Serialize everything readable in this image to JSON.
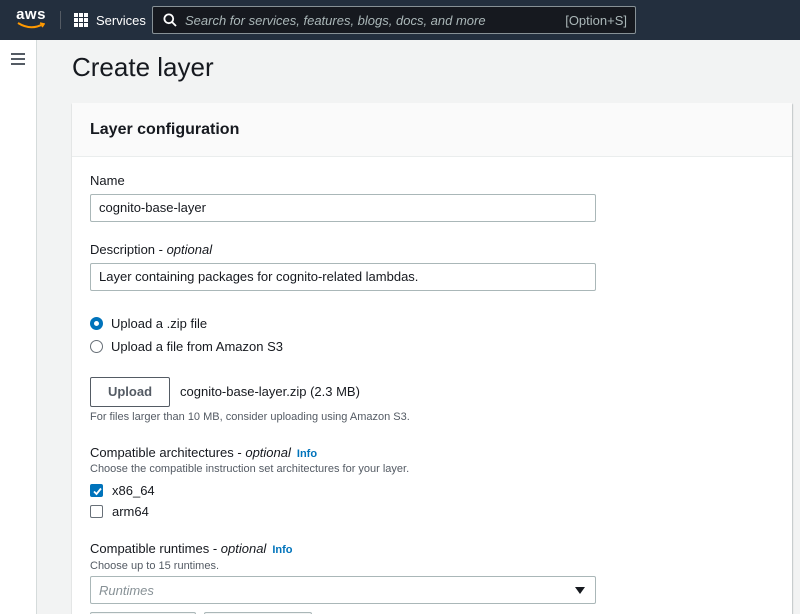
{
  "nav": {
    "logo_text": "aws",
    "services_label": "Services",
    "search_placeholder": "Search for services, features, blogs, docs, and more",
    "search_shortcut": "[Option+S]"
  },
  "page": {
    "title": "Create layer"
  },
  "panel": {
    "title": "Layer configuration",
    "name_label": "Name",
    "name_value": "cognito-base-layer",
    "description_label": "Description - ",
    "description_optional": "optional",
    "description_value": "Layer containing packages for cognito-related lambdas.",
    "upload_options": [
      {
        "label": "Upload a .zip file",
        "selected": true
      },
      {
        "label": "Upload a file from Amazon S3",
        "selected": false
      }
    ],
    "upload_button": "Upload",
    "file_name": "cognito-base-layer.zip (2.3 MB)",
    "upload_hint": "For files larger than 10 MB, consider uploading using Amazon S3.",
    "architectures_label": "Compatible architectures - ",
    "architectures_optional": "optional",
    "architectures_info": "Info",
    "architectures_hint": "Choose the compatible instruction set architectures for your layer.",
    "architectures": [
      {
        "label": "x86_64",
        "checked": true
      },
      {
        "label": "arm64",
        "checked": false
      }
    ],
    "runtimes_label": "Compatible runtimes - ",
    "runtimes_optional": "optional",
    "runtimes_info": "Info",
    "runtimes_hint": "Choose up to 15 runtimes.",
    "runtimes_placeholder": "Runtimes"
  },
  "colors": {
    "nav_bg": "#232f3e",
    "accent": "#0073bb",
    "aws_orange": "#ff9900"
  }
}
